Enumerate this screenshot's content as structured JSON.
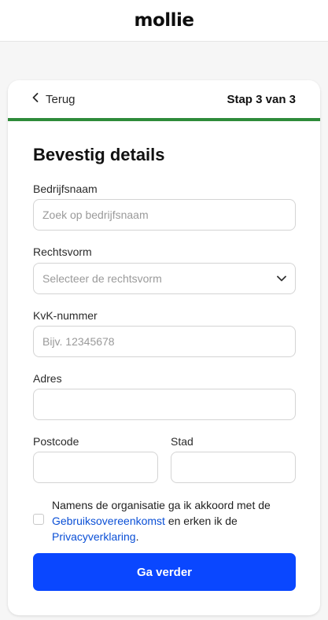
{
  "brand": {
    "logo_text": "mollie"
  },
  "header": {
    "back_label": "Terug",
    "step_label": "Stap 3 van 3",
    "progress_fraction": 1.0
  },
  "form": {
    "title": "Bevestig details",
    "company": {
      "label": "Bedrijfsnaam",
      "placeholder": "Zoek op bedrijfsnaam",
      "value": ""
    },
    "legal_form": {
      "label": "Rechtsvorm",
      "placeholder": "Selecteer de rechtsvorm"
    },
    "kvk": {
      "label": "KvK-nummer",
      "placeholder": "Bijv. 12345678",
      "value": ""
    },
    "address": {
      "label": "Adres",
      "value": ""
    },
    "postcode": {
      "label": "Postcode",
      "value": ""
    },
    "city": {
      "label": "Stad",
      "value": ""
    },
    "consent": {
      "checked": false,
      "text_1": "Namens de organisatie ga ik akkoord met de",
      "link_terms": "Gebruiksovereenkomst",
      "text_2": "en erken ik de",
      "link_privacy": "Privacyverklaring",
      "text_3": "."
    },
    "submit_label": "Ga verder"
  },
  "colors": {
    "accent": "#0a47ff",
    "progress": "#2e8b3a",
    "link": "#0a4fd6"
  },
  "icons": {
    "back": "chevron-left-icon",
    "select": "chevron-down-icon"
  }
}
